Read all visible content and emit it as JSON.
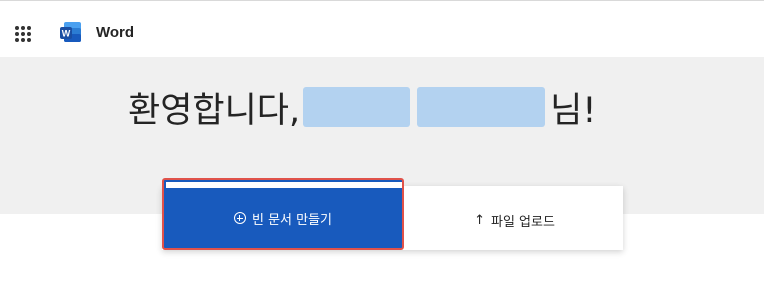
{
  "header": {
    "app_name": "Word",
    "app_launcher_icon": "waffle-grid-icon",
    "logo_icon": "word-logo-icon",
    "brand_color": "#185abd"
  },
  "hero": {
    "greeting_prefix": "환영합니다,",
    "greeting_suffix": "님!",
    "background_color": "#f0f0f0"
  },
  "actions": {
    "new_document": {
      "icon": "plus-circle-icon",
      "label": "빈 문서 만들기"
    },
    "upload": {
      "icon": "arrow-up-icon",
      "label": "파일 업로드"
    }
  }
}
